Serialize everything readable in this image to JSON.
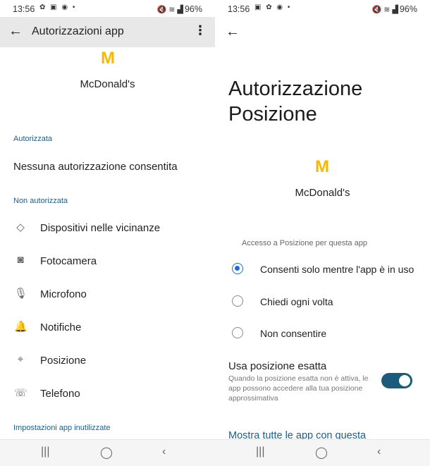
{
  "left": {
    "status": {
      "time": "13:56",
      "icons_left": "✿ ▣ ◉ •",
      "icons_right": "🔇 ≋ ▟",
      "battery": "96%"
    },
    "appbar": {
      "back_icon": "←",
      "title": "Autorizzazioni app",
      "more_icon": "⋮"
    },
    "app": {
      "logo": "M",
      "name": "McDonald's"
    },
    "allowed": {
      "section": "Autorizzata",
      "text": "Nessuna autorizzazione consentita"
    },
    "denied": {
      "section": "Non autorizzata",
      "items": [
        {
          "icon": "nearby-devices-icon",
          "glyph": "◇",
          "label": "Dispositivi nelle vicinanze"
        },
        {
          "icon": "camera-icon",
          "glyph": "◙",
          "label": "Fotocamera"
        },
        {
          "icon": "microphone-icon",
          "glyph": "🎙",
          "label": "Microfono"
        },
        {
          "icon": "bell-icon",
          "glyph": "🔔",
          "label": "Notifiche"
        },
        {
          "icon": "location-pin-icon",
          "glyph": "⌖",
          "label": "Posizione"
        },
        {
          "icon": "phone-icon",
          "glyph": "☏",
          "label": "Telefono"
        }
      ]
    },
    "unused": {
      "section": "Impostazioni app inutilizzate"
    },
    "nav": {
      "recent": "|||",
      "home": "◯",
      "back": "‹"
    }
  },
  "right": {
    "status": {
      "time": "13:56",
      "icons_left": "▣ ✿ ◉ •",
      "icons_right": "🔇 ≋ ▟",
      "battery": "96%"
    },
    "back_icon": "←",
    "title_line1": "Autorizzazione",
    "title_line2": "Posizione",
    "app": {
      "logo": "M",
      "name": "McDonald's"
    },
    "access_label": "Accesso a Posizione per questa app",
    "options": [
      {
        "label": "Consenti solo mentre l'app è in uso",
        "selected": true
      },
      {
        "label": "Chiedi ogni volta",
        "selected": false
      },
      {
        "label": "Non consentire",
        "selected": false
      }
    ],
    "exact": {
      "title": "Usa posizione esatta",
      "desc": "Quando la posizione esatta non è attiva, le app possono accedere alla tua posizione approssimativa",
      "enabled": true
    },
    "show_all": "Mostra tutte le app con questa",
    "nav": {
      "recent": "|||",
      "home": "◯",
      "back": "‹"
    }
  },
  "colors": {
    "accent": "#1b5e8c",
    "radio": "#1b6fd1",
    "toggle": "#1d5b7a",
    "logo": "#f6b900",
    "appbar": "#e8e8e8"
  }
}
